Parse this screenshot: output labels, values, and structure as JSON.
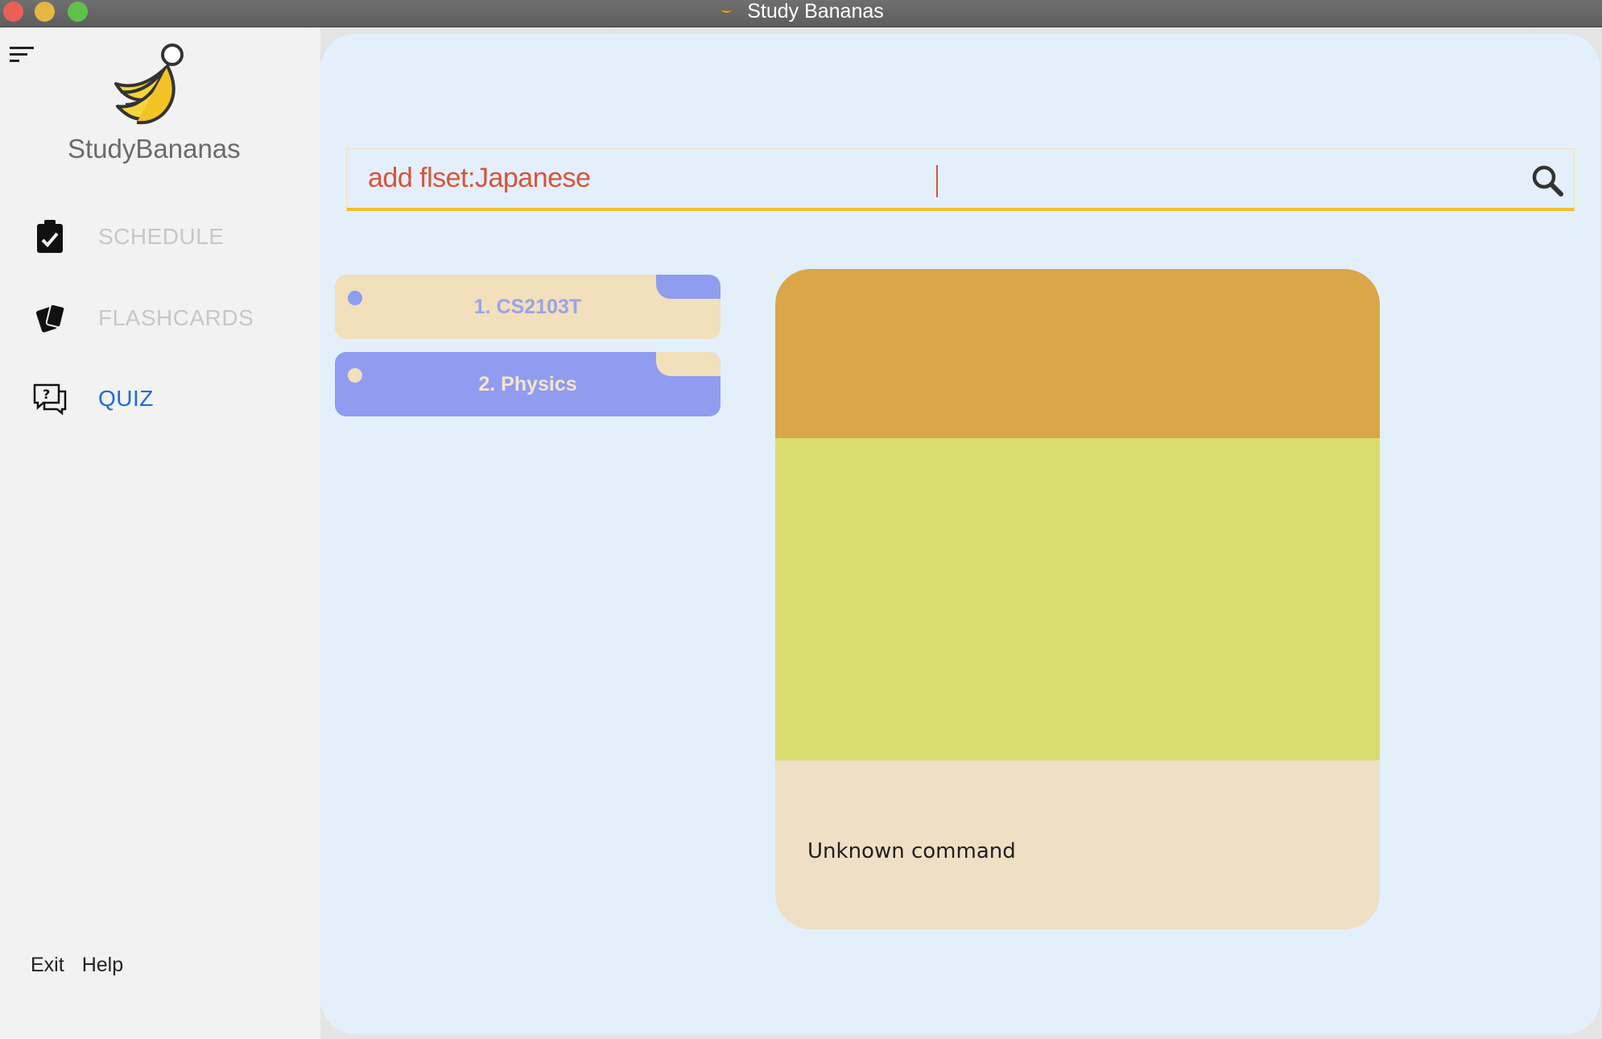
{
  "window": {
    "title": "Study Bananas"
  },
  "sidebar": {
    "brand": "StudyBananas",
    "menu_icon": "hamburger-menu-icon",
    "nav": [
      {
        "label": "SCHEDULE",
        "icon": "clipboard-check-icon",
        "active": false
      },
      {
        "label": "FLASHCARDS",
        "icon": "cards-icon",
        "active": false
      },
      {
        "label": "QUIZ",
        "icon": "question-chat-icon",
        "active": true
      }
    ],
    "footer": {
      "exit": "Exit",
      "help": "Help"
    }
  },
  "command_bar": {
    "value": "add flset:Japanese",
    "icon": "search-icon"
  },
  "flashcard_sets": [
    {
      "label": "1. CS2103T"
    },
    {
      "label": "2. Physics"
    }
  ],
  "result_display": {
    "message": "Unknown command"
  },
  "colors": {
    "accent_yellow": "#f3c02c",
    "command_text": "#d9533a",
    "active_nav": "#1e6ad6",
    "set_purple": "#8f9cf0",
    "set_beige": "#f2dfbc",
    "panel_bg": "#e3f0fc"
  }
}
